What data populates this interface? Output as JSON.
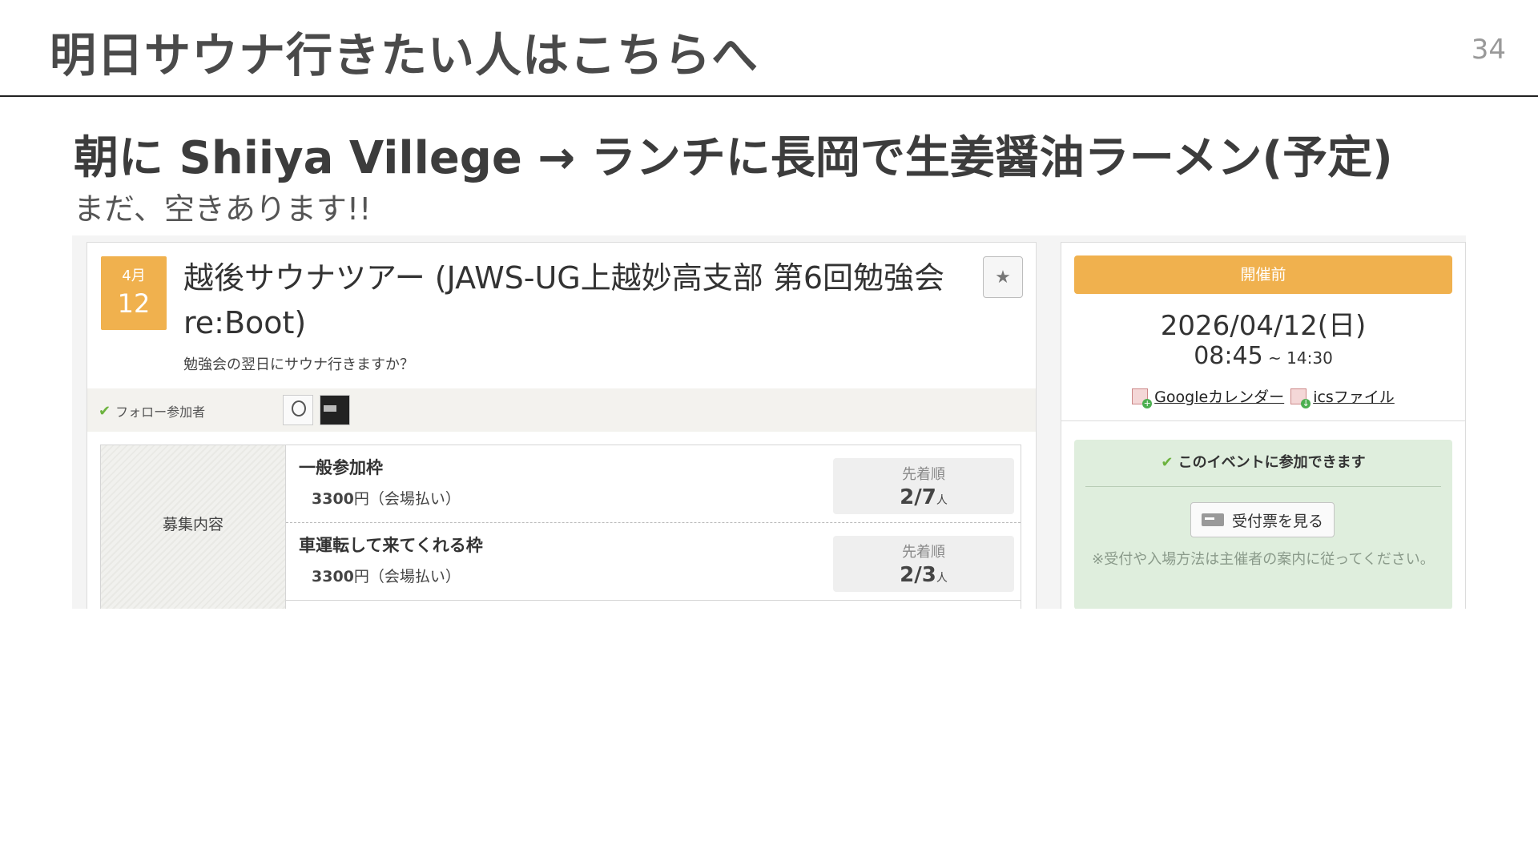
{
  "slide": {
    "title": "明日サウナ行きたい人はこちらへ",
    "page_number": "34",
    "subheading": "朝に Shiiya Villege → ランチに長岡で生姜醤油ラーメン(予定)",
    "note": "まだ、空きあります!!"
  },
  "event": {
    "month": "4月",
    "day": "12",
    "title": "越後サウナツアー (JAWS-UG上越妙高支部 第6回勉強会 re:Boot)",
    "description": "勉強会の翌日にサウナ行きますか？",
    "follow_label": "フォロー参加者",
    "recruit_label": "募集内容",
    "slots": [
      {
        "name": "一般参加枠",
        "price": "3300",
        "price_suffix": "円（会場払い）",
        "order": "先着順",
        "count": "2/7",
        "unit": "人"
      },
      {
        "name": "車運転して来てくれる枠",
        "price": "3300",
        "price_suffix": "円（会場払い）",
        "order": "先着順",
        "count": "2/3",
        "unit": "人"
      }
    ]
  },
  "side": {
    "status": "開催前",
    "date": "2026/04/12(日)",
    "start_time": "08:45",
    "time_sep": " ~ ",
    "end_time": "14:30",
    "google_calendar": "Googleカレンダー",
    "ics_file": "icsファイル",
    "join_message": "このイベントに参加できます",
    "ticket_button": "受付票を見る",
    "notice": "※受付や入場方法は主催者の案内に従ってください。"
  },
  "icons": {
    "bookmark": "star-icon",
    "check": "check-icon",
    "calendar": "calendar-add-icon",
    "ics": "calendar-download-icon",
    "ticket": "ticket-icon"
  },
  "colors": {
    "accent": "#f0b14e",
    "join_panel": "#dfeedd",
    "check": "#6cb33e"
  }
}
